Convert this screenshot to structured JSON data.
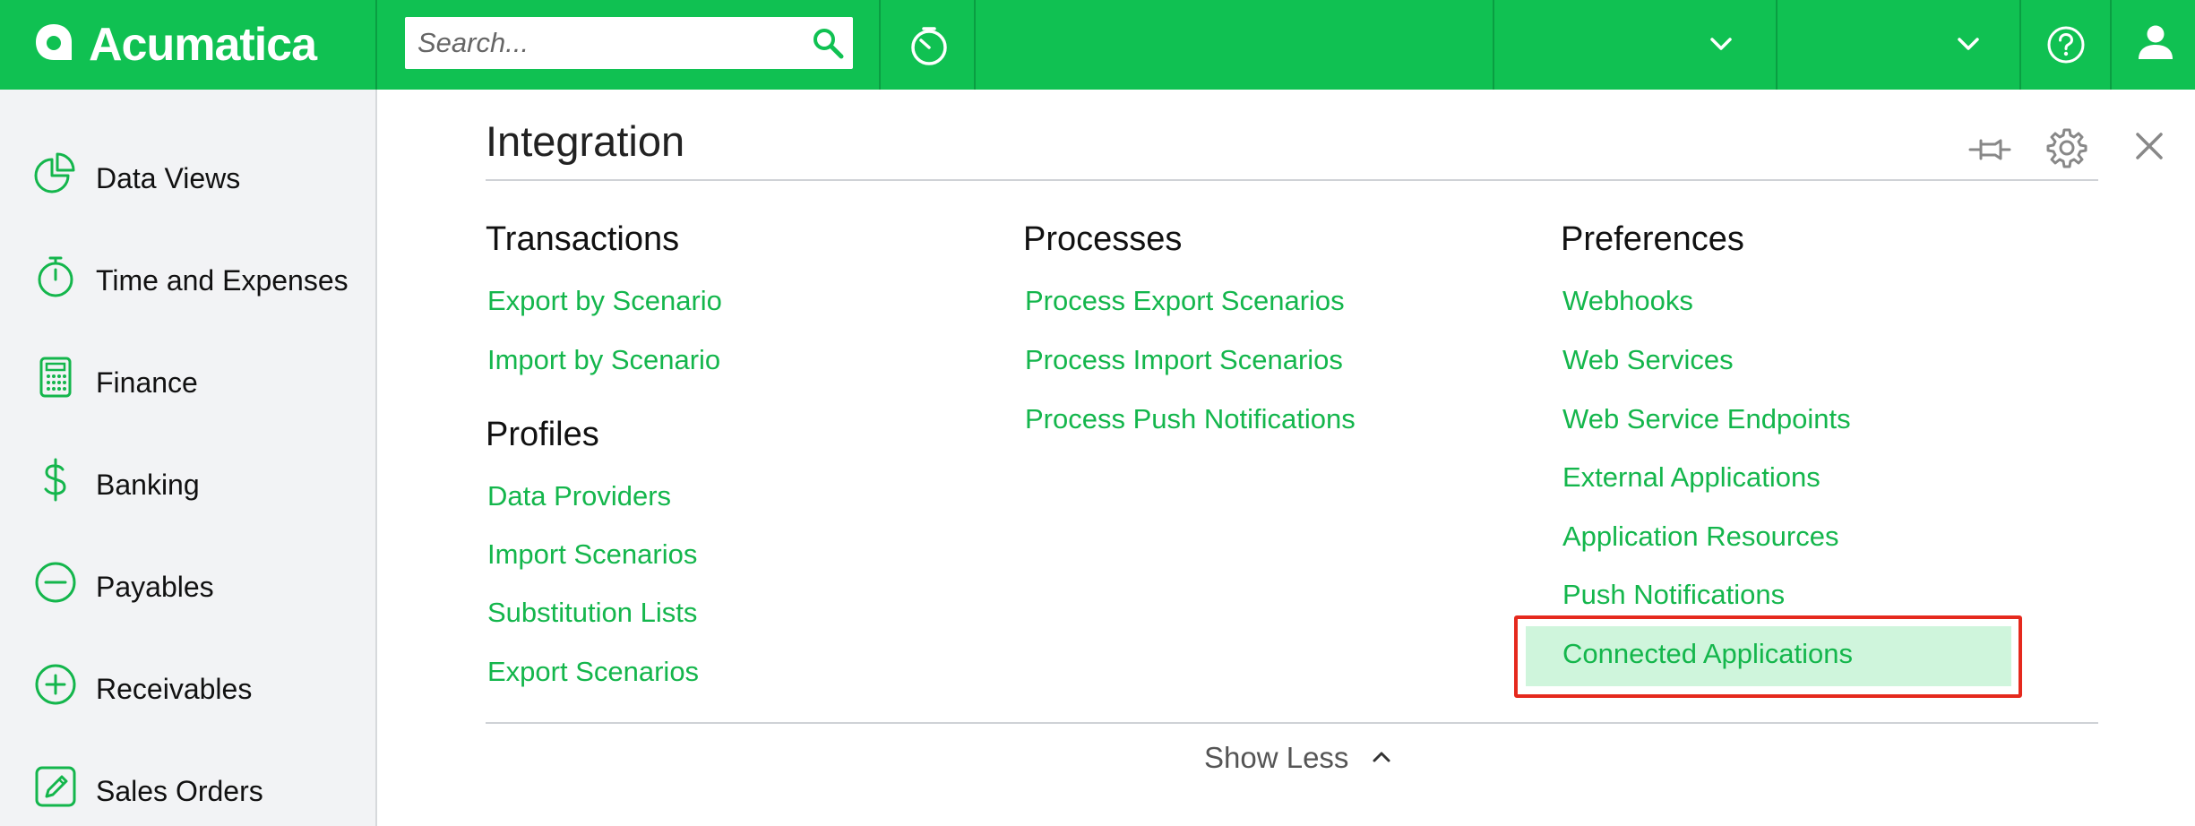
{
  "app": {
    "logo_text": "Acumatica",
    "brand_color": "#10c152",
    "link_color": "#14b64c",
    "highlight_color": "#cff5dc",
    "annotation_color": "#e5291d"
  },
  "topbar": {
    "search_placeholder": "Search...",
    "icons": [
      "search-icon",
      "timer-icon",
      "chevron-down-icon",
      "chevron-down-icon",
      "help-icon",
      "user-icon"
    ]
  },
  "sidebar": {
    "items": [
      {
        "label": "Data Views",
        "icon": "pie-chart-icon"
      },
      {
        "label": "Time and Expenses",
        "icon": "stopwatch-icon"
      },
      {
        "label": "Finance",
        "icon": "calculator-icon"
      },
      {
        "label": "Banking",
        "icon": "dollar-icon"
      },
      {
        "label": "Payables",
        "icon": "minus-circle-icon"
      },
      {
        "label": "Receivables",
        "icon": "plus-circle-icon"
      },
      {
        "label": "Sales Orders",
        "icon": "pencil-icon"
      }
    ]
  },
  "panel": {
    "title": "Integration",
    "toolbar_icons": [
      "pin-icon",
      "gear-icon",
      "close-icon"
    ],
    "transactions": {
      "heading": "Transactions",
      "links": [
        "Export by Scenario",
        "Import by Scenario"
      ]
    },
    "profiles": {
      "heading": "Profiles",
      "links": [
        "Data Providers",
        "Import Scenarios",
        "Substitution Lists",
        "Export Scenarios"
      ]
    },
    "processes": {
      "heading": "Processes",
      "links": [
        "Process Export Scenarios",
        "Process Import Scenarios",
        "Process Push Notifications"
      ]
    },
    "preferences": {
      "heading": "Preferences",
      "links": [
        "Webhooks",
        "Web Services",
        "Web Service Endpoints",
        "External Applications",
        "Application Resources",
        "Push Notifications",
        "Connected Applications"
      ],
      "selected": "Connected Applications"
    },
    "show_less_label": "Show Less"
  }
}
